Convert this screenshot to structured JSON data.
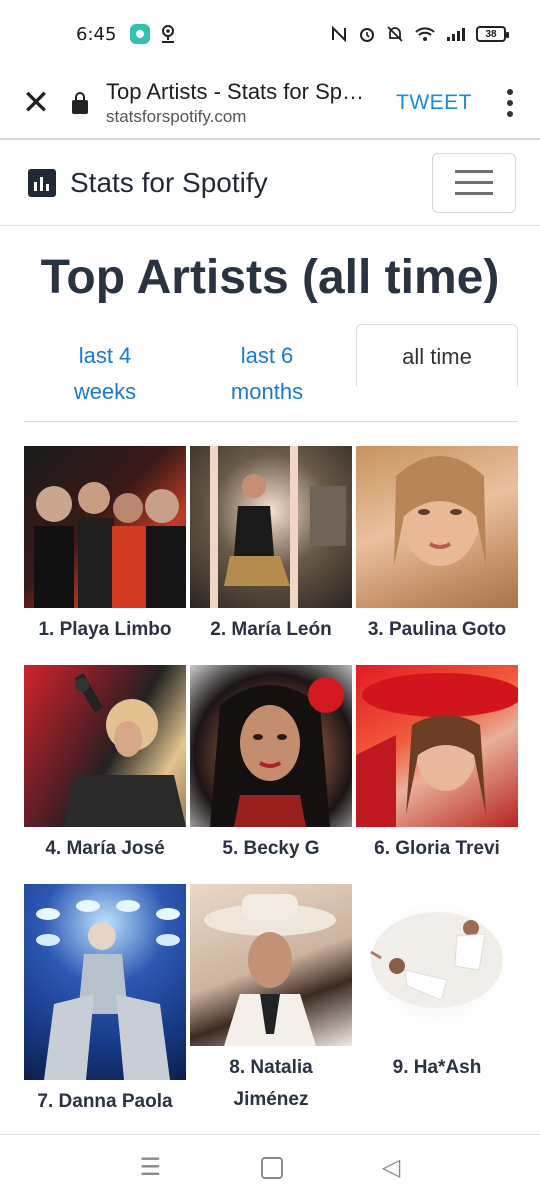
{
  "status_bar": {
    "time": "6:45",
    "battery": "38"
  },
  "browser": {
    "page_title": "Top Artists - Stats for Spotify",
    "url": "statsforspotify.com",
    "tweet_label": "TWEET"
  },
  "site": {
    "brand": "Stats for Spotify"
  },
  "main": {
    "heading": "Top Artists (all time)",
    "tabs": [
      {
        "label": "last 4\nweeks",
        "active": false
      },
      {
        "label": "last 6\nmonths",
        "active": false
      },
      {
        "label": "all time",
        "active": true
      }
    ],
    "artists": [
      {
        "label": "1. Playa Limbo"
      },
      {
        "label": "2. María León"
      },
      {
        "label": "3. Paulina Goto"
      },
      {
        "label": "4. María José"
      },
      {
        "label": "5. Becky G"
      },
      {
        "label": "6. Gloria Trevi"
      },
      {
        "label": "7. Danna Paola"
      },
      {
        "label": "8. Natalia Jiménez"
      },
      {
        "label": "9. Ha*Ash"
      }
    ]
  },
  "icons": {
    "close": "close-icon",
    "lock": "lock-icon",
    "more": "more-vert-icon",
    "brand": "bar-chart-icon",
    "menu": "hamburger-menu-icon",
    "nav_menu": "recent-apps-icon",
    "nav_home": "home-icon",
    "nav_back": "back-icon"
  },
  "colors": {
    "link": "#1a7ad0",
    "tweet": "#1a8ad6",
    "heading": "#2a3342"
  }
}
